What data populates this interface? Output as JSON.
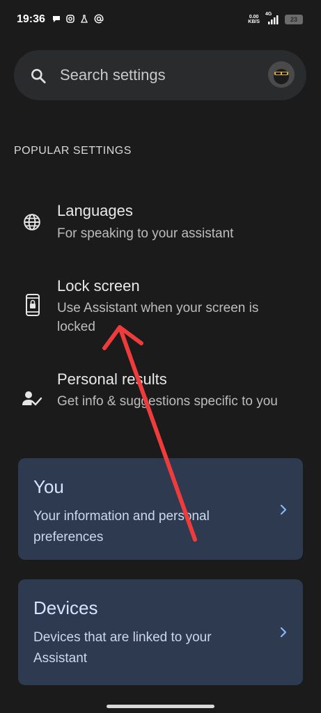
{
  "status_bar": {
    "time": "19:36",
    "netspeed_value": "0.00",
    "netspeed_unit": "KB/S",
    "network": "4G",
    "battery": "23"
  },
  "search": {
    "placeholder": "Search settings"
  },
  "popular_settings": {
    "header": "POPULAR SETTINGS",
    "items": [
      {
        "title": "Languages",
        "subtitle": "For speaking to your assistant",
        "icon": "globe-icon"
      },
      {
        "title": "Lock screen",
        "subtitle": "Use Assistant when your screen is locked",
        "icon": "phone-lock-icon"
      },
      {
        "title": "Personal results",
        "subtitle": "Get info & suggestions specific to you",
        "icon": "person-check-icon"
      }
    ]
  },
  "cards": [
    {
      "title": "You",
      "subtitle": "Your information and personal preferences",
      "icon": "chevron-right-icon"
    },
    {
      "title": "Devices",
      "subtitle": "Devices that are linked to your Assistant",
      "icon": "chevron-right-icon"
    }
  ],
  "colors": {
    "background": "#1b1b1b",
    "search_bar": "#2a2b2d",
    "card": "#2d3a4f",
    "card_title": "#d6e3fb",
    "chevron": "#8ab4f8",
    "annotation_arrow": "#ee3b3b"
  }
}
